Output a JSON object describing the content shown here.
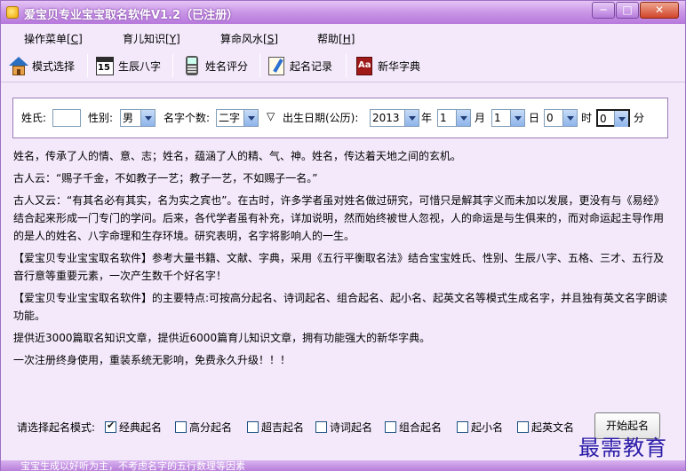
{
  "window": {
    "title": "爱宝贝专业宝宝取名软件V1.2（已注册）",
    "min_label": "─",
    "max_label": "□",
    "close_label": "✕"
  },
  "menu": {
    "items": [
      {
        "label": "操作菜单",
        "key": "[C]"
      },
      {
        "label": "育儿知识",
        "key": "[Y]"
      },
      {
        "label": "算命风水",
        "key": "[S]"
      },
      {
        "label": "帮助",
        "key": "[H]"
      }
    ]
  },
  "toolbar": {
    "mode": "模式选择",
    "bazi": "生辰八字",
    "score": "姓名评分",
    "record": "起名记录",
    "dict": "新华字典",
    "cal_number": "15",
    "book_text": "Aa"
  },
  "form": {
    "surname_label": "姓氏:",
    "surname_value": "",
    "gender_label": "性别:",
    "gender_value": "男",
    "count_label": "名字个数:",
    "count_value": "二字",
    "birth_marker": "▽",
    "birth_label": "出生日期(公历):",
    "year_value": "2013",
    "year_unit": "年",
    "month_value": "1",
    "month_unit": "月",
    "day_value": "1",
    "day_unit": "日",
    "hour_value": "0",
    "hour_unit": "时",
    "minute_value": "0",
    "minute_unit": "分"
  },
  "content": {
    "p1": "姓名，传承了人的情、意、志；姓名，蕴涵了人的精、气、神。姓名，传达着天地之间的玄机。",
    "p2": "古人云：“赐子千金，不如教子一艺；教子一艺，不如赐子一名。”",
    "p3": "古人又云：“有其名必有其实，名为实之宾也”。在古时，许多学者虽对姓名做过研究，可惜只是解其字义而未加以发展，更没有与《易经》结合起来形成一门专门的学问。后来，各代学者虽有补充，详加说明，然而始终被世人忽视，人的命运是与生俱来的，而对命运起主导作用的是人的姓名、八字命理和生存环境。研究表明，名字将影响人的一生。",
    "p4": "【爱宝贝专业宝宝取名软件】参考大量书籍、文献、字典，采用《五行平衡取名法》结合宝宝姓氏、性别、生辰八字、五格、三才、五行及音行意等重要元素，一次产生数千个好名字！",
    "p5": "【爱宝贝专业宝宝取名软件】的主要特点:可按高分起名、诗词起名、组合起名、起小名、起英文名等模式生成名字，并且独有英文名字朗读功能。",
    "p6": "提供近3000篇取名知识文章，提供近6000篇育儿知识文章，拥有功能强大的新华字典。",
    "p7": "一次注册终身使用，重装系统无影响，免费永久升级！！！"
  },
  "modes": {
    "label": "请选择起名模式:",
    "options": [
      {
        "label": "经典起名",
        "checked": true
      },
      {
        "label": "高分起名",
        "checked": false
      },
      {
        "label": "超吉起名",
        "checked": false
      },
      {
        "label": "诗词起名",
        "checked": false
      },
      {
        "label": "组合起名",
        "checked": false
      },
      {
        "label": "起小名",
        "checked": false
      },
      {
        "label": "起英文名",
        "checked": false
      }
    ],
    "start_button": "开始起名"
  },
  "status": {
    "text": "宝宝生成以好听为主，不考虑名字的五行数理等因素"
  },
  "watermark": "最需教育"
}
